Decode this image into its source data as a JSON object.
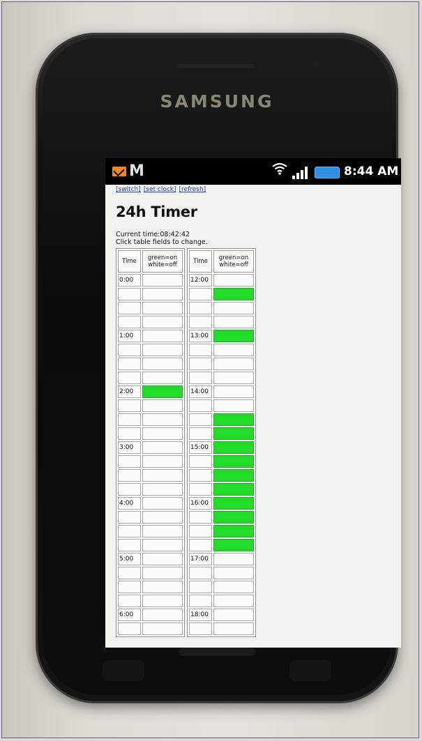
{
  "device": {
    "brand": "SAMSUNG"
  },
  "statusbar": {
    "time": "8:44 AM",
    "icons": [
      "mail-icon",
      "gmail-icon",
      "wifi-icon",
      "signal-icon",
      "battery-icon"
    ],
    "gmail_glyph": "M",
    "wifi_glyph": "⌒"
  },
  "page": {
    "links": [
      "[switch]",
      "[set clock]",
      "[refresh]"
    ],
    "title": "24h Timer",
    "current_time_label": "Current time:08:42:42",
    "instructions": "Click table fields to change.",
    "headers": {
      "time": "Time",
      "status": "green=on white=off"
    },
    "colors": {
      "on": "#22dc2a",
      "off": "#fafaf8"
    },
    "left_table": [
      {
        "time": "0:00",
        "on": false
      },
      {
        "time": "",
        "on": false
      },
      {
        "time": "",
        "on": false
      },
      {
        "time": "",
        "on": false
      },
      {
        "time": "1:00",
        "on": false
      },
      {
        "time": "",
        "on": false
      },
      {
        "time": "",
        "on": false
      },
      {
        "time": "",
        "on": false
      },
      {
        "time": "2:00",
        "on": true
      },
      {
        "time": "",
        "on": false
      },
      {
        "time": "",
        "on": false
      },
      {
        "time": "",
        "on": false
      },
      {
        "time": "3:00",
        "on": false
      },
      {
        "time": "",
        "on": false
      },
      {
        "time": "",
        "on": false
      },
      {
        "time": "",
        "on": false
      },
      {
        "time": "4:00",
        "on": false
      },
      {
        "time": "",
        "on": false
      },
      {
        "time": "",
        "on": false
      },
      {
        "time": "",
        "on": false
      },
      {
        "time": "5:00",
        "on": false
      },
      {
        "time": "",
        "on": false
      },
      {
        "time": "",
        "on": false
      },
      {
        "time": "",
        "on": false
      },
      {
        "time": "6:00",
        "on": false
      },
      {
        "time": "",
        "on": false
      }
    ],
    "right_table": [
      {
        "time": "12:00",
        "on": false
      },
      {
        "time": "",
        "on": true
      },
      {
        "time": "",
        "on": false
      },
      {
        "time": "",
        "on": false
      },
      {
        "time": "13:00",
        "on": true
      },
      {
        "time": "",
        "on": false
      },
      {
        "time": "",
        "on": false
      },
      {
        "time": "",
        "on": false
      },
      {
        "time": "14:00",
        "on": false
      },
      {
        "time": "",
        "on": false
      },
      {
        "time": "",
        "on": true
      },
      {
        "time": "",
        "on": true
      },
      {
        "time": "15:00",
        "on": true
      },
      {
        "time": "",
        "on": true
      },
      {
        "time": "",
        "on": true
      },
      {
        "time": "",
        "on": true
      },
      {
        "time": "16:00",
        "on": true
      },
      {
        "time": "",
        "on": true
      },
      {
        "time": "",
        "on": true
      },
      {
        "time": "",
        "on": true
      },
      {
        "time": "17:00",
        "on": false
      },
      {
        "time": "",
        "on": false
      },
      {
        "time": "",
        "on": false
      },
      {
        "time": "",
        "on": false
      },
      {
        "time": "18:00",
        "on": false
      },
      {
        "time": "",
        "on": false
      }
    ]
  }
}
